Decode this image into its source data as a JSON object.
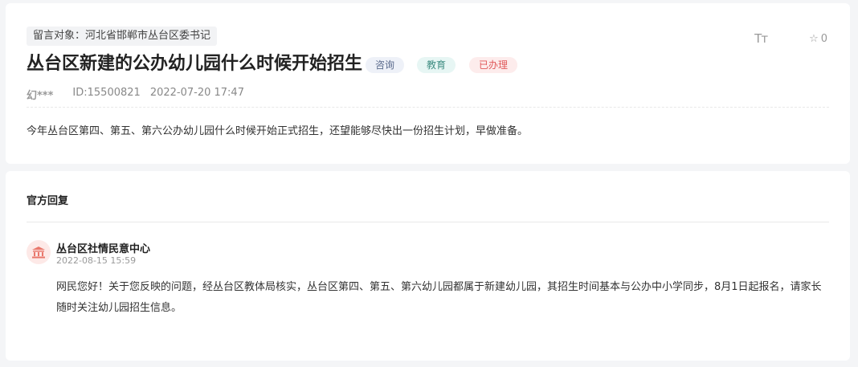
{
  "message": {
    "target": "留言对象：河北省邯郸市丛台区委书记",
    "title": "丛台区新建的公办幼儿园什么时候开始招生",
    "tags": [
      "咨询",
      "教育",
      "已办理"
    ],
    "tools": {
      "font_icon": "Tт",
      "star_count": "0"
    },
    "author": "幻***",
    "id": "ID:15500821",
    "time": "2022-07-20 17:47",
    "content": "今年丛台区第四、第五、第六公办幼儿园什么时候开始正式招生，还望能够尽快出一份招生计划，早做准备。"
  },
  "reply": {
    "heading": "官方回复",
    "org": "丛台区社情民意中心",
    "time": "2022-08-15 15:59",
    "text": "网民您好！关于您反映的问题，经丛台区教体局核实，丛台区第四、第五、第六幼儿园都属于新建幼儿园，其招生时间基本与公办中小学同步，8月1日起报名，请家长随时关注幼儿园招生信息。"
  },
  "icons": {
    "font_size": "font-size-icon",
    "star": "star-icon",
    "org": "government-building-icon"
  },
  "colors": {
    "tag_consult": "#5a6a8c",
    "tag_edu": "#3f8d82",
    "tag_done": "#e0595a",
    "avatar_bg": "#fde9e7"
  }
}
